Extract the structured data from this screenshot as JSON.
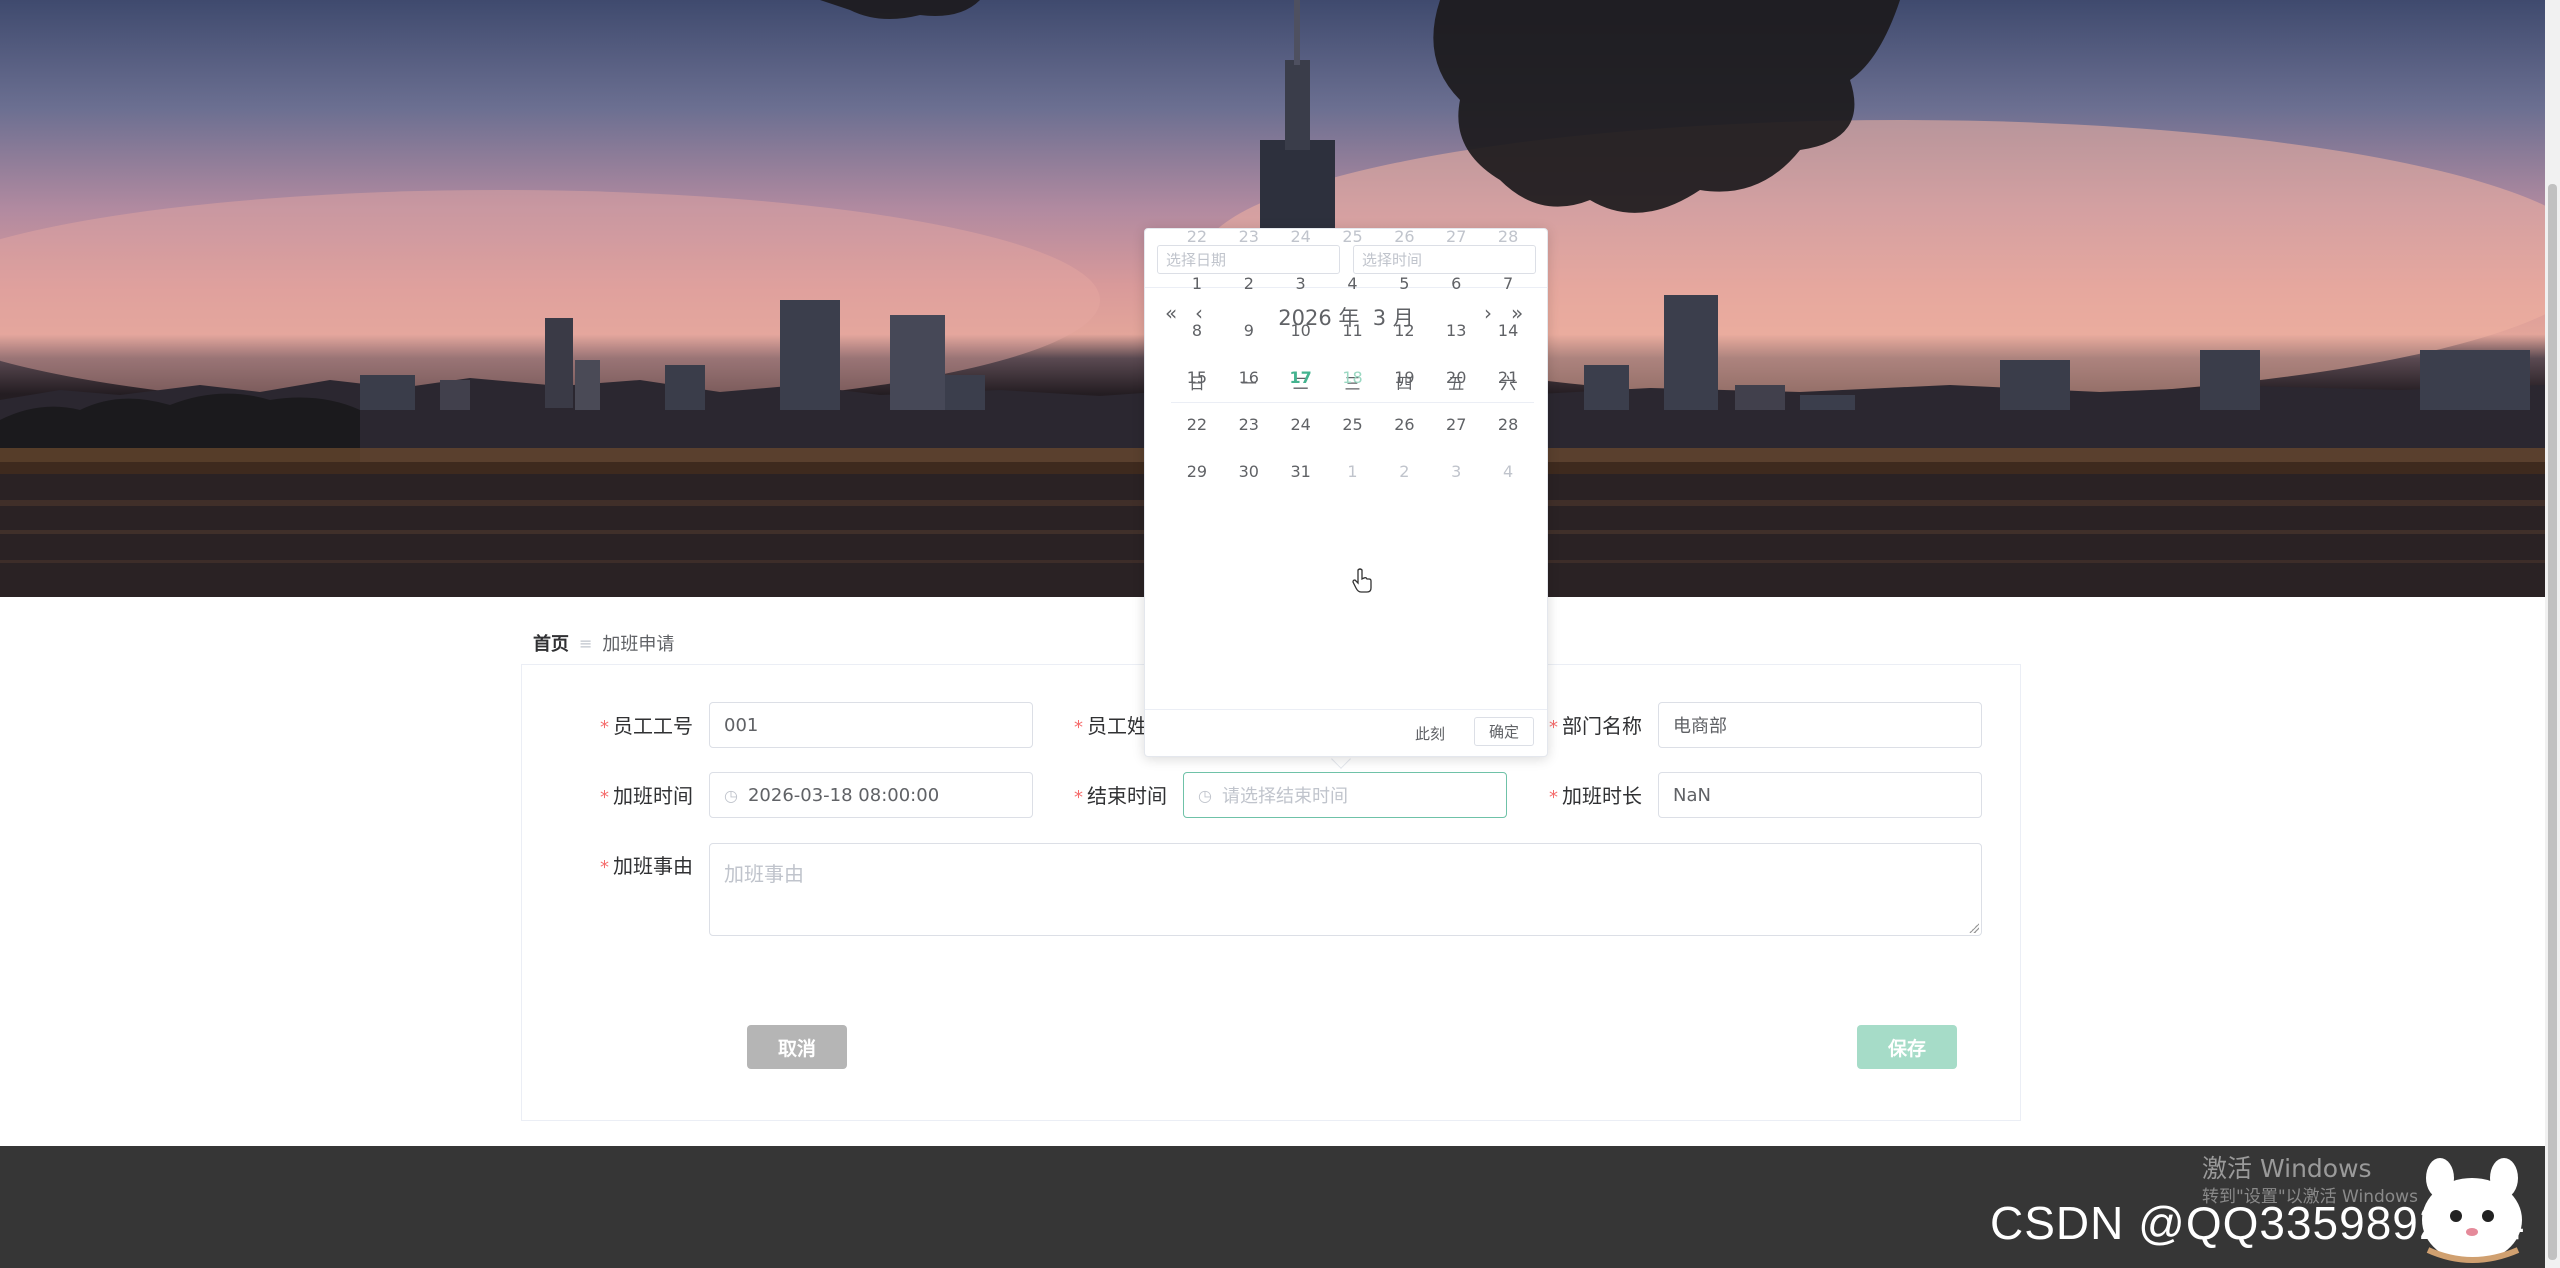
{
  "breadcrumb": {
    "home": "首页",
    "separator": "≡",
    "current": "加班申请"
  },
  "form": {
    "employee_id": {
      "label": "员工工号",
      "value": "001"
    },
    "employee_name": {
      "label": "员工姓"
    },
    "department": {
      "label": "部门名称",
      "value": "电商部"
    },
    "start_time": {
      "label": "加班时间",
      "value": "2026-03-18 08:00:00"
    },
    "end_time": {
      "label": "结束时间",
      "placeholder": "请选择结束时间"
    },
    "duration": {
      "label": "加班时长",
      "value": "NaN"
    },
    "reason": {
      "label": "加班事由",
      "placeholder": "加班事由"
    },
    "required_mark": "*",
    "cancel_label": "取消",
    "save_label": "保存"
  },
  "picker": {
    "date_placeholder": "选择日期",
    "time_placeholder": "选择时间",
    "year_label": "2026 年",
    "month_label": "3 月",
    "weekdays": [
      "日",
      "一",
      "二",
      "三",
      "四",
      "五",
      "六"
    ],
    "weeks": [
      [
        {
          "d": "22",
          "t": "other"
        },
        {
          "d": "23",
          "t": "other"
        },
        {
          "d": "24",
          "t": "other"
        },
        {
          "d": "25",
          "t": "other"
        },
        {
          "d": "26",
          "t": "other"
        },
        {
          "d": "27",
          "t": "other"
        },
        {
          "d": "28",
          "t": "other"
        }
      ],
      [
        {
          "d": "1",
          "t": "cur"
        },
        {
          "d": "2",
          "t": "cur"
        },
        {
          "d": "3",
          "t": "cur"
        },
        {
          "d": "4",
          "t": "cur"
        },
        {
          "d": "5",
          "t": "cur"
        },
        {
          "d": "6",
          "t": "cur"
        },
        {
          "d": "7",
          "t": "cur"
        }
      ],
      [
        {
          "d": "8",
          "t": "cur"
        },
        {
          "d": "9",
          "t": "cur"
        },
        {
          "d": "10",
          "t": "cur"
        },
        {
          "d": "11",
          "t": "cur"
        },
        {
          "d": "12",
          "t": "cur"
        },
        {
          "d": "13",
          "t": "cur"
        },
        {
          "d": "14",
          "t": "cur"
        }
      ],
      [
        {
          "d": "15",
          "t": "cur"
        },
        {
          "d": "16",
          "t": "cur"
        },
        {
          "d": "17",
          "t": "today"
        },
        {
          "d": "18",
          "t": "hover"
        },
        {
          "d": "19",
          "t": "cur"
        },
        {
          "d": "20",
          "t": "cur"
        },
        {
          "d": "21",
          "t": "cur"
        }
      ],
      [
        {
          "d": "22",
          "t": "cur"
        },
        {
          "d": "23",
          "t": "cur"
        },
        {
          "d": "24",
          "t": "cur"
        },
        {
          "d": "25",
          "t": "cur"
        },
        {
          "d": "26",
          "t": "cur"
        },
        {
          "d": "27",
          "t": "cur"
        },
        {
          "d": "28",
          "t": "cur"
        }
      ],
      [
        {
          "d": "29",
          "t": "cur"
        },
        {
          "d": "30",
          "t": "cur"
        },
        {
          "d": "31",
          "t": "cur"
        },
        {
          "d": "1",
          "t": "other"
        },
        {
          "d": "2",
          "t": "other"
        },
        {
          "d": "3",
          "t": "other"
        },
        {
          "d": "4",
          "t": "other"
        }
      ]
    ],
    "now_label": "此刻",
    "confirm_label": "确定",
    "nav_icons": {
      "prev_year": "«",
      "prev_month": "‹",
      "next_month": "›",
      "next_year": "»"
    }
  },
  "icons": {
    "clock": "◷"
  },
  "windows_activation": {
    "title": "激活 Windows",
    "subtitle": "转到\"设置\"以激活 Windows"
  },
  "watermark": "CSDN @QQ3359892174",
  "colors": {
    "accent": "#44b38f",
    "required": "#f56c6c",
    "footer": "#363636",
    "save_button": "#a6dcc8",
    "cancel_button": "#b5b5b5"
  }
}
